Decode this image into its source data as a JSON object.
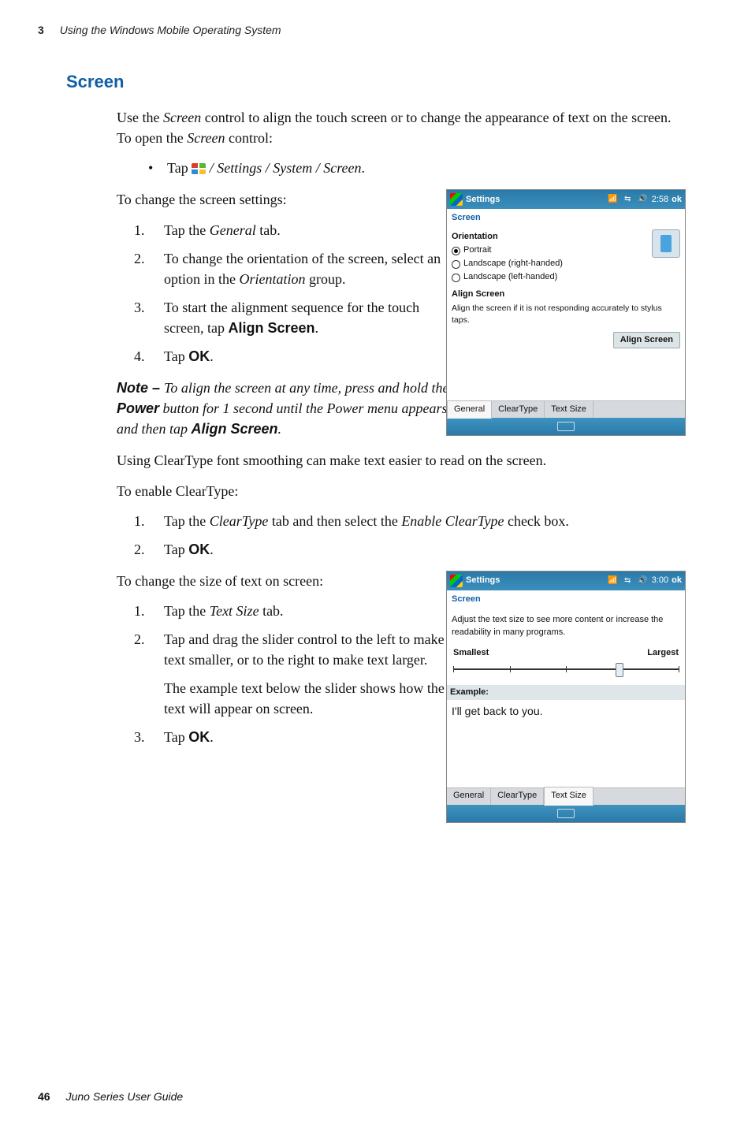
{
  "header": {
    "chapter_num": "3",
    "chapter_title": "Using the Windows Mobile Operating System"
  },
  "section": {
    "title": "Screen"
  },
  "intro": {
    "p1a": "Use the ",
    "p1_it": "Screen",
    "p1b": " control to align the touch screen or to change the appearance of text on the screen. To open the ",
    "p1_it2": "Screen",
    "p1c": " control:",
    "bullet_pre": "Tap ",
    "bullet_path": " / Settings / System / Screen",
    "bullet_dot": "."
  },
  "change_settings": {
    "lead": "To change the screen settings:",
    "s1a": "Tap the ",
    "s1_it": "General",
    "s1b": " tab.",
    "s2a": "To change the orientation of the screen, select an option in the ",
    "s2_it": "Orientation",
    "s2b": " group.",
    "s3a": "To start the alignment sequence for the touch screen, tap ",
    "s3_b": "Align Screen",
    "s3c": ".",
    "s4a": "Tap ",
    "s4_b": "OK",
    "s4c": "."
  },
  "note": {
    "lead": "Note – ",
    "t1": "To align the screen at any time, press and hold the ",
    "b1": "Power",
    "t2": " button for 1 second until the Power menu appears and then tap ",
    "b2": "Align Screen",
    "t3": "."
  },
  "cleartype": {
    "p": "Using ClearType font smoothing can make text easier to read on the screen.",
    "lead": "To enable ClearType:",
    "s1a": "Tap the ",
    "s1_it": "ClearType",
    "s1b": " tab and then select the ",
    "s1_it2": "Enable ClearType",
    "s1c": " check box.",
    "s2a": "Tap ",
    "s2_b": "OK",
    "s2c": "."
  },
  "textsize": {
    "lead": "To change the size of text on screen:",
    "s1a": "Tap the ",
    "s1_it": "Text Size",
    "s1b": " tab.",
    "s2": "Tap and drag the slider control to the left to make text smaller, or to the right to make text larger.",
    "s2p": "The example text below the slider shows how the text will appear on screen.",
    "s3a": "Tap ",
    "s3_b": "OK",
    "s3c": "."
  },
  "shot1": {
    "title": "Settings",
    "time": "2:58",
    "ok": "ok",
    "sub": "Screen",
    "grp": "Orientation",
    "opt1": "Portrait",
    "opt2": "Landscape (right-handed)",
    "opt3": "Landscape (left-handed)",
    "align_h": "Align Screen",
    "align_desc": "Align the screen if it is not responding accurately to stylus taps.",
    "align_btn": "Align Screen",
    "tab1": "General",
    "tab2": "ClearType",
    "tab3": "Text Size"
  },
  "shot2": {
    "title": "Settings",
    "time": "3:00",
    "ok": "ok",
    "sub": "Screen",
    "desc": "Adjust the text size to see more content or increase the readability in many programs.",
    "small": "Smallest",
    "large": "Largest",
    "ex_h": "Example:",
    "ex_t": "I'll get back to you.",
    "tab1": "General",
    "tab2": "ClearType",
    "tab3": "Text Size"
  },
  "footer": {
    "page_num": "46",
    "book": "Juno Series User Guide"
  }
}
